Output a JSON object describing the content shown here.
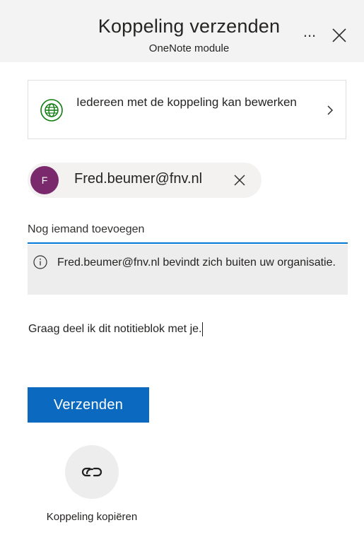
{
  "header": {
    "title": "Koppeling verzenden",
    "subtitle": "OneNote module",
    "more_label": "...",
    "close_icon": "close-icon"
  },
  "permission": {
    "text": "Iedereen met de koppeling kan bewerken",
    "icon": "globe-icon",
    "chevron_icon": "chevron-right-icon",
    "icon_color": "#107c10"
  },
  "recipient": {
    "avatar_initial": "F",
    "avatar_color": "#7a2a6c",
    "email": "Fred.beumer@fnv.nl",
    "remove_icon": "close-icon"
  },
  "add_person": {
    "placeholder": "Nog iemand toevoegen",
    "value": "",
    "underline_color": "#0078d4"
  },
  "info": {
    "icon": "info-icon",
    "text": "Fred.beumer@fnv.nl bevindt zich buiten uw organisatie."
  },
  "message": {
    "value": "Graag deel ik dit notitieblok met je."
  },
  "send_button": {
    "label": "Verzenden",
    "color": "#0b6ac0"
  },
  "copy_link": {
    "icon": "link-icon",
    "label": "Koppeling kopiëren"
  }
}
